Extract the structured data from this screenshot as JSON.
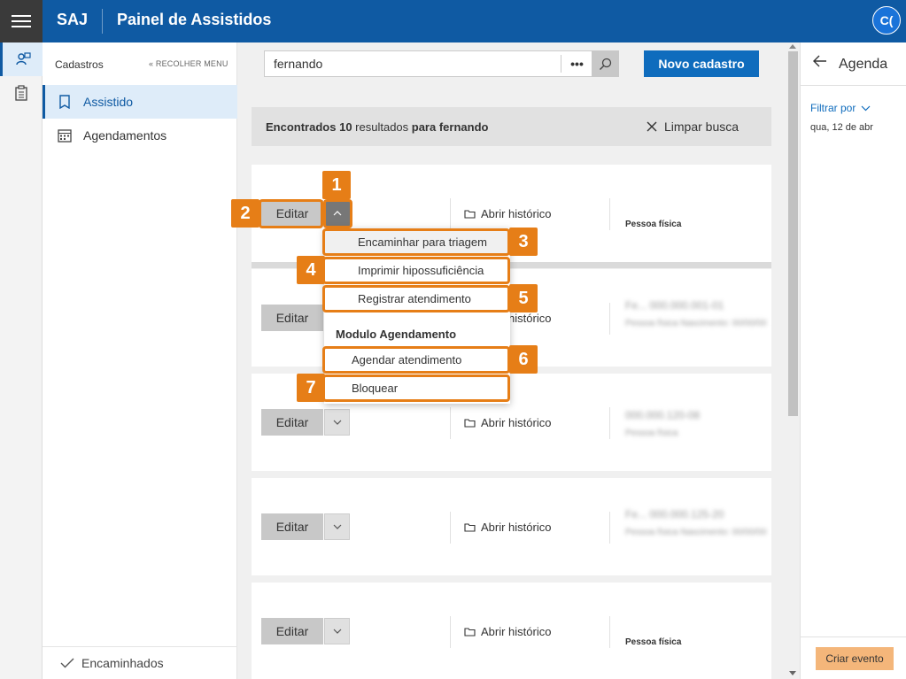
{
  "topbar": {
    "brand": "SAJ",
    "title": "Painel de Assistidos",
    "avatar_initials": "C("
  },
  "sidebar": {
    "header": "Cadastros",
    "collapse_label": "« RECOLHER MENU",
    "items": [
      {
        "label": "Assistido",
        "icon": "book-icon",
        "active": true
      },
      {
        "label": "Agendamentos",
        "icon": "calendar-icon",
        "active": false
      }
    ],
    "footer": "Encaminhados"
  },
  "search": {
    "value": "fernando",
    "more_label": "•••",
    "new_button": "Novo cadastro"
  },
  "results": {
    "prefix": "Encontrados",
    "count": "10",
    "middle": " resultados ",
    "for_label": "para fernando",
    "clear_label": "Limpar busca"
  },
  "cards": [
    {
      "edit": "Editar",
      "history": "Abrir histórico",
      "person_type": "Pessoa física",
      "blur_line1": "",
      "blur_line2": ""
    },
    {
      "edit": "Editar",
      "history": "Abrir histórico",
      "person_type": "",
      "blur_line1": "Fe...   000.000.001-01",
      "blur_line2": "Pessoa física   Nascimento: 00/00/00"
    },
    {
      "edit": "Editar",
      "history": "Abrir histórico",
      "person_type": "",
      "blur_line1": "   000.000.120-08",
      "blur_line2": "Pessoa física"
    },
    {
      "edit": "Editar",
      "history": "Abrir histórico",
      "person_type": "",
      "blur_line1": "Fe...   000.000.125-20",
      "blur_line2": "Pessoa física   Nascimento: 00/00/00"
    },
    {
      "edit": "Editar",
      "history": "Abrir histórico",
      "person_type": "Pessoa física",
      "blur_line1": "",
      "blur_line2": ""
    }
  ],
  "menu": {
    "items": [
      "Encaminhar para triagem",
      "Imprimir hipossuficiência",
      "Registrar atendimento"
    ],
    "section_header": "Modulo Agendamento",
    "section_items": [
      "Agendar atendimento",
      "Bloquear"
    ]
  },
  "callouts": [
    "1",
    "2",
    "3",
    "4",
    "5",
    "6",
    "7"
  ],
  "agenda": {
    "title": "Agenda",
    "filter_label": "Filtrar por",
    "date": "qua, 12 de abr",
    "create_button": "Criar evento"
  },
  "colors": {
    "brand_blue": "#0f5aa3",
    "primary_button": "#0f6cbd",
    "callout_orange": "#e67e17",
    "create_button": "#f4b67a"
  }
}
